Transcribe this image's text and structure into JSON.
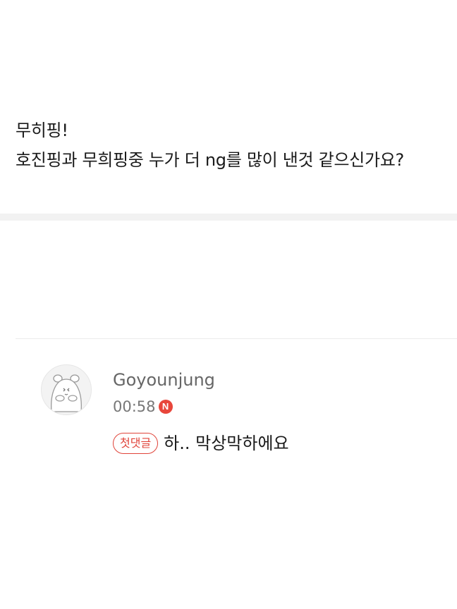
{
  "post": {
    "line1": "무히핑!",
    "line2": "호진핑과 무희핑중 누가 더 ng를 많이 낸것 같으신가요?"
  },
  "comment": {
    "author": "Goyounjung",
    "time": "00:58",
    "new_badge": "N",
    "first_comment_badge": "첫댓글",
    "text": "하.. 막상막하에요",
    "avatar_icon": "hamster-avatar-icon"
  },
  "colors": {
    "accent_red": "#e0443a",
    "divider_gray": "#f2f2f2",
    "meta_gray": "#777777"
  }
}
